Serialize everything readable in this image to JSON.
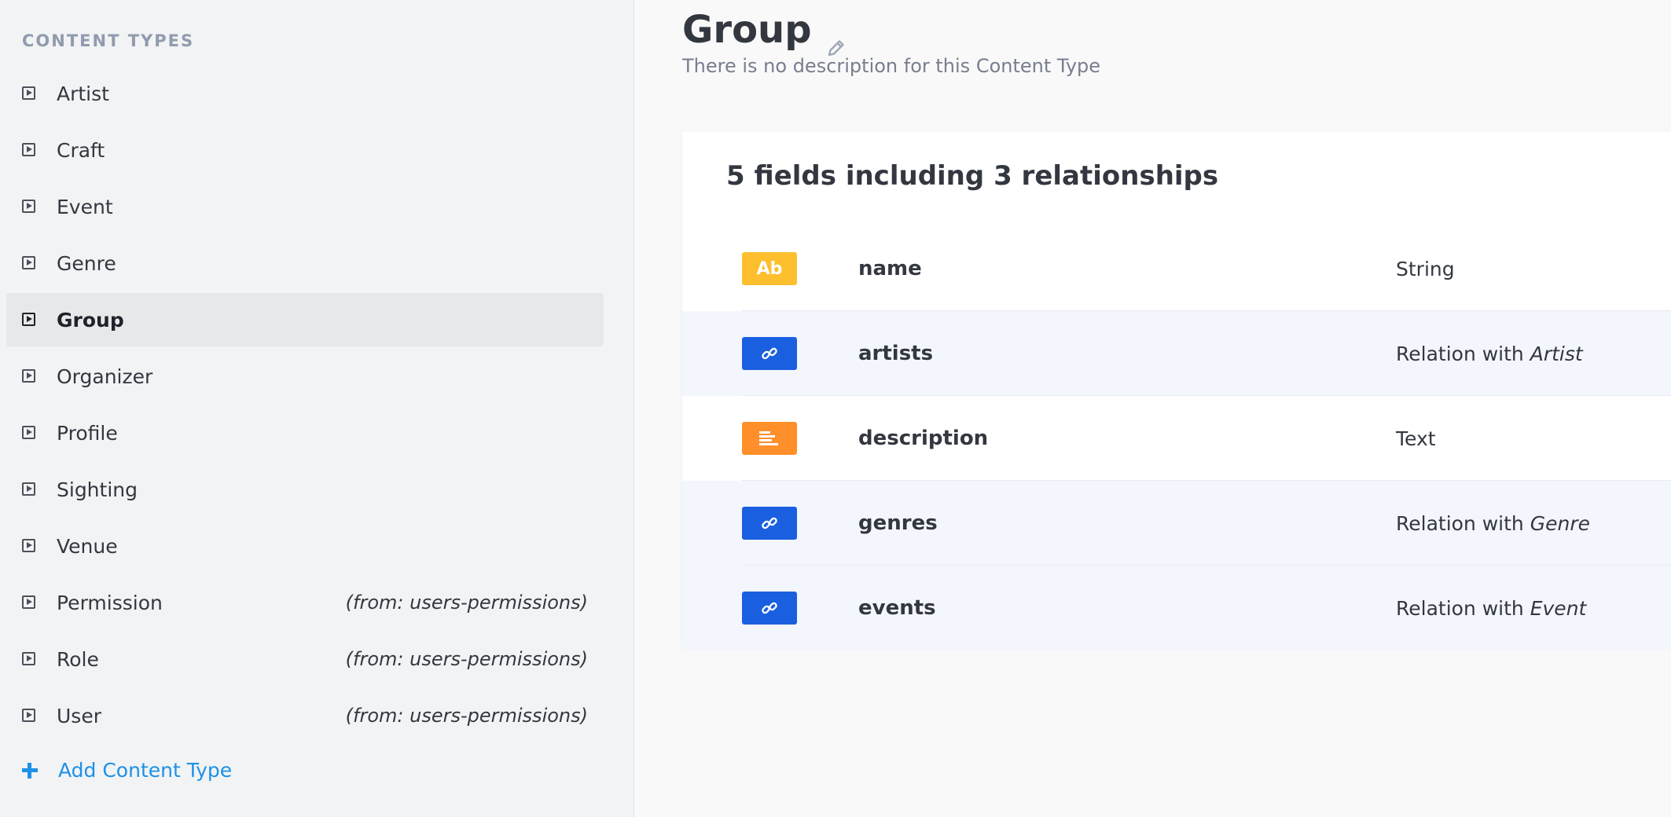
{
  "sidebar": {
    "title": "CONTENT TYPES",
    "items": [
      {
        "label": "Artist",
        "source": "",
        "active": false
      },
      {
        "label": "Craft",
        "source": "",
        "active": false
      },
      {
        "label": "Event",
        "source": "",
        "active": false
      },
      {
        "label": "Genre",
        "source": "",
        "active": false
      },
      {
        "label": "Group",
        "source": "",
        "active": true
      },
      {
        "label": "Organizer",
        "source": "",
        "active": false
      },
      {
        "label": "Profile",
        "source": "",
        "active": false
      },
      {
        "label": "Sighting",
        "source": "",
        "active": false
      },
      {
        "label": "Venue",
        "source": "",
        "active": false
      },
      {
        "label": "Permission",
        "source": "(from: users-permissions)",
        "active": false
      },
      {
        "label": "Role",
        "source": "(from: users-permissions)",
        "active": false
      },
      {
        "label": "User",
        "source": "(from: users-permissions)",
        "active": false
      }
    ],
    "add_label": "Add Content Type"
  },
  "header": {
    "title": "Group",
    "description": "There is no description for this Content Type"
  },
  "fields_card": {
    "title": "5 fields including 3 relationships",
    "rows": [
      {
        "name": "name",
        "type_prefix": "String",
        "type_target": "",
        "icon": "string-icon",
        "badge_text": "Ab"
      },
      {
        "name": "artists",
        "type_prefix": "Relation with ",
        "type_target": "Artist",
        "icon": "link-icon",
        "badge_text": ""
      },
      {
        "name": "description",
        "type_prefix": "Text",
        "type_target": "",
        "icon": "text-align-icon",
        "badge_text": ""
      },
      {
        "name": "genres",
        "type_prefix": "Relation with ",
        "type_target": "Genre",
        "icon": "link-icon",
        "badge_text": ""
      },
      {
        "name": "events",
        "type_prefix": "Relation with ",
        "type_target": "Event",
        "icon": "link-icon",
        "badge_text": ""
      }
    ]
  },
  "colors": {
    "accent": "#1c91e7",
    "string_badge": "#fdbf2e",
    "text_badge": "#ff8f2a",
    "relation_badge": "#1a5fe0"
  }
}
